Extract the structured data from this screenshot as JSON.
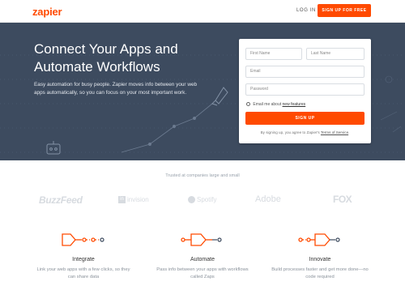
{
  "header": {
    "logo": "zapier",
    "login_label": "LOG IN",
    "signup_label": "SIGN UP FOR FREE"
  },
  "hero": {
    "headline_line1": "Connect Your Apps and",
    "headline_line2": "Automate Workflows",
    "subtext": "Easy automation for busy people. Zapier moves info between your web apps automatically, so you can focus on your most important work."
  },
  "form": {
    "first_name_placeholder": "First Name",
    "last_name_placeholder": "Last Name",
    "email_placeholder": "Email",
    "password_placeholder": "Password",
    "checkbox_text": "Email me about",
    "checkbox_link": "new features",
    "signup_button": "SIGN UP",
    "terms_text": "By signing up, you agree to Zapier's",
    "terms_link": "Terms of Service",
    "terms_end": "."
  },
  "trusted": {
    "heading": "Trusted at companies large and small",
    "logos": [
      "BuzzFeed",
      "invision",
      "Spotify",
      "Adobe",
      "FOX"
    ],
    "invision_mark": "in"
  },
  "features": [
    {
      "title": "Integrate",
      "text": "Link your web apps with a few clicks, so they can share data"
    },
    {
      "title": "Automate",
      "text": "Pass info between your apps with workflows called Zaps"
    },
    {
      "title": "Innovate",
      "text": "Build processes faster and get more done—no code required"
    }
  ],
  "colors": {
    "brand_orange": "#ff4a00",
    "hero_bg": "#3d4b5f"
  }
}
